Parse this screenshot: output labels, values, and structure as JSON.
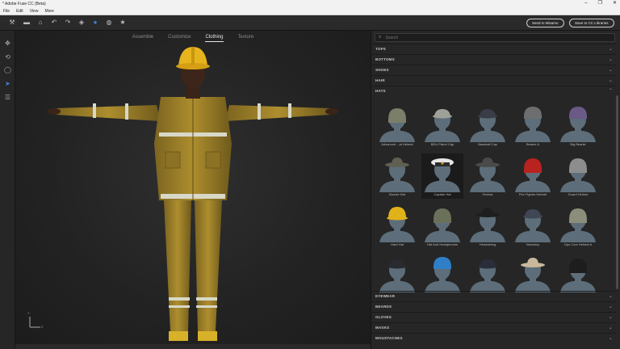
{
  "window": {
    "title": "* Adobe Fuse CC (Beta)",
    "controls": [
      "–",
      "❐",
      "✕"
    ]
  },
  "menu": [
    "File",
    "Edit",
    "View",
    "More"
  ],
  "toolbar": {
    "send_mixamo": "Send to Mixamo",
    "save_cc": "Save to CC Libraries"
  },
  "tabs": [
    {
      "label": "Assemble",
      "active": false
    },
    {
      "label": "Customize",
      "active": false
    },
    {
      "label": "Clothing",
      "active": true
    },
    {
      "label": "Texture",
      "active": false
    }
  ],
  "axis": {
    "y": "Y",
    "z": "Z"
  },
  "search": {
    "placeholder": "Search"
  },
  "categories_top": [
    "TOPS",
    "BOTTOMS",
    "SHOES",
    "HAIR"
  ],
  "active_category": "HATS",
  "hats": [
    {
      "label": "Advanced ...at Helmet",
      "color": "#7b7f6a",
      "shape": "helmet"
    },
    {
      "label": "BDU Patrol Cap",
      "color": "#9ea198",
      "shape": "cap"
    },
    {
      "label": "Baseball Cap",
      "color": "#3a3d47",
      "shape": "cap"
    },
    {
      "label": "Beanie A",
      "color": "#6c6e70",
      "shape": "beanie"
    },
    {
      "label": "Big Beanie",
      "color": "#6a5a86",
      "shape": "beanie"
    },
    {
      "label": "Boonie Hat",
      "color": "#5f6052",
      "shape": "brim"
    },
    {
      "label": "Captain Hat",
      "color": "#e6e6e6",
      "shape": "captain",
      "selected": true
    },
    {
      "label": "Fedora",
      "color": "#4a4a4a",
      "shape": "brim"
    },
    {
      "label": "Fire Fighter Helmet",
      "color": "#b8231f",
      "shape": "helmet"
    },
    {
      "label": "Guard Helmet",
      "color": "#8d8d8d",
      "shape": "helmet"
    },
    {
      "label": "Hard Hat",
      "color": "#e0b21a",
      "shape": "hardhat"
    },
    {
      "label": "Hat And Headphones",
      "color": "#6b7059",
      "shape": "helmet"
    },
    {
      "label": "Heisenberg",
      "color": "#1e1e1e",
      "shape": "brim"
    },
    {
      "label": "Newsboy",
      "color": "#3f4654",
      "shape": "cap"
    },
    {
      "label": "Ops Core Helmet A",
      "color": "#8a8e7a",
      "shape": "helmet"
    },
    {
      "label": "",
      "color": "#2a2a30",
      "shape": "cap"
    },
    {
      "label": "",
      "color": "#2f7fc7",
      "shape": "beanie"
    },
    {
      "label": "",
      "color": "#2a2e3a",
      "shape": "cap"
    },
    {
      "label": "",
      "color": "#c9b89a",
      "shape": "brim"
    },
    {
      "label": "",
      "color": "#1d1d1d",
      "shape": "helmet"
    }
  ],
  "categories_bottom": [
    "EYEWEAR",
    "BEARDS",
    "GLOVES",
    "MASKS",
    "MOUSTACHES"
  ],
  "colors": {
    "bust": "#5d6e7a",
    "suit": "#a88a2c",
    "helmet": "#e6b41c",
    "reflective": "#d8d8c8"
  }
}
